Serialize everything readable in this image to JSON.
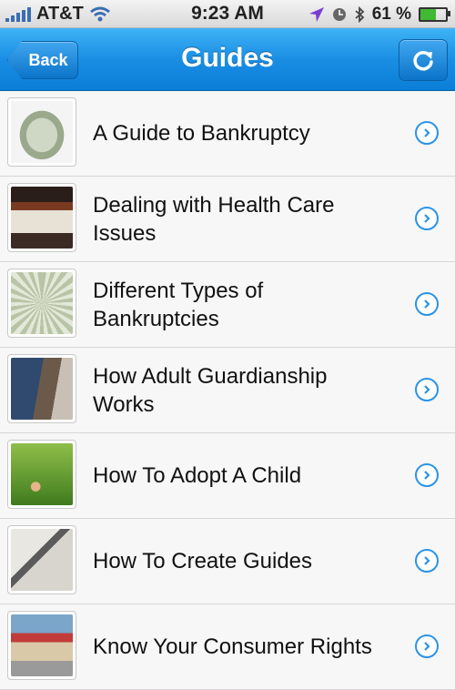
{
  "status_bar": {
    "carrier": "AT&T",
    "time": "9:23 AM",
    "battery_percent": "61 %",
    "battery_level": 0.61
  },
  "nav": {
    "back_label": "Back",
    "title": "Guides"
  },
  "guides": [
    {
      "label": "A Guide to Bankruptcy"
    },
    {
      "label": "Dealing with Health Care Issues"
    },
    {
      "label": "Different Types of Bankruptcies"
    },
    {
      "label": "How Adult Guardianship Works"
    },
    {
      "label": "How To Adopt A Child"
    },
    {
      "label": "How To Create Guides"
    },
    {
      "label": "Know Your Consumer Rights"
    }
  ],
  "colors": {
    "accent": "#1a8ee3",
    "disclosure": "#2a93e6"
  }
}
